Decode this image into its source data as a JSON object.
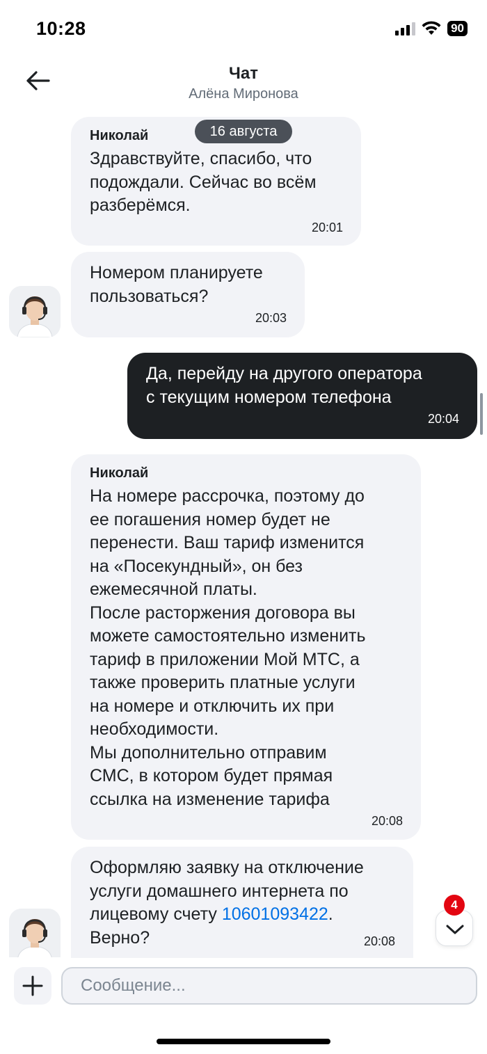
{
  "status_bar": {
    "time": "10:28",
    "battery": "90"
  },
  "header": {
    "title": "Чат",
    "subtitle": "Алёна Миронова"
  },
  "date_separator": "16 августа",
  "messages": [
    {
      "sender": "Николай",
      "text": "Здравствуйте, спасибо, что\nподождали. Сейчас во всём\nразберёмся.",
      "time": "20:01",
      "direction": "incoming"
    },
    {
      "text": "Номером планируете\nпользоваться?",
      "time": "20:03",
      "direction": "incoming"
    },
    {
      "text": "Да, перейду на другого оператора\nс текущим номером телефона",
      "time": "20:04",
      "direction": "outgoing"
    },
    {
      "sender": "Николай",
      "text": "На номере рассрочка, поэтому до\nее погашения номер будет не\nперенести. Ваш тариф изменится\nна «Посекундный», он без\nежемесячной платы.\nПосле расторжения договора вы\nможете самостоятельно изменить\nтариф в приложении Мой МТС, а\nтакже проверить платные услуги\nна номере и отключить их при\nнеобходимости.\nМы дополнительно отправим\nСМС, в котором будет прямая\nссылка на изменение тарифа",
      "time": "20:08",
      "direction": "incoming"
    },
    {
      "text_before": "Оформляю заявку на отключение\nуслуги домашнего интернета по\nлицевому счету ",
      "link": "10601093422",
      "text_after": ".\nВерно?",
      "time": "20:08",
      "direction": "incoming"
    }
  ],
  "scroll_down": {
    "unread_count": "4"
  },
  "composer": {
    "placeholder": "Сообщение..."
  },
  "colors": {
    "accent_red": "#e30611",
    "link_blue": "#0070e5",
    "bubble_in": "#f2f3f7",
    "bubble_out": "#1d2023"
  },
  "icons": [
    "back-arrow-icon",
    "signal-icon",
    "wifi-icon",
    "battery-icon",
    "chevron-down-icon",
    "plus-icon",
    "operator-avatar-icon"
  ]
}
